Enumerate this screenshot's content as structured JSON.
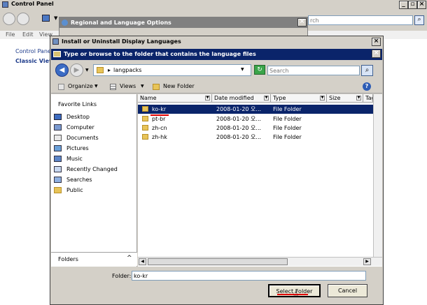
{
  "control_panel": {
    "title": "Control Panel",
    "menu": [
      "File",
      "Edit",
      "View"
    ],
    "search_placeholder": "rch",
    "left_link": "Control Panel",
    "left_link2": "Classic View"
  },
  "regional": {
    "title": "Regional and Language Options"
  },
  "dialog": {
    "title": "Install or Uninstall Display Languages",
    "prompt": "Type or browse to the folder that contains the language files",
    "breadcrumb": "langpacks",
    "search_placeholder": "Search",
    "toolbar": {
      "organize": "Organize",
      "views": "Views",
      "new_folder": "New Folder"
    },
    "favorites_header": "Favorite Links",
    "favorites": [
      "Desktop",
      "Computer",
      "Documents",
      "Pictures",
      "Music",
      "Recently Changed",
      "Searches",
      "Public"
    ],
    "folders_label": "Folders",
    "columns": [
      "Name",
      "Date modified",
      "Type",
      "Size",
      "Tag"
    ],
    "files": [
      {
        "name": "ko-kr",
        "date": "2008-01-20 오...",
        "type": "File Folder"
      },
      {
        "name": "pt-br",
        "date": "2008-01-20 오...",
        "type": "File Folder"
      },
      {
        "name": "zh-cn",
        "date": "2008-01-20 오...",
        "type": "File Folder"
      },
      {
        "name": "zh-hk",
        "date": "2008-01-20 오...",
        "type": "File Folder"
      }
    ],
    "folder_label": "Folder:",
    "folder_value": "ko-kr",
    "select_button": "Select Folder",
    "cancel_button": "Cancel"
  },
  "colors": {
    "selection": "#0a246a",
    "titlebar": "#0a246a",
    "annotation": "#e00000"
  }
}
